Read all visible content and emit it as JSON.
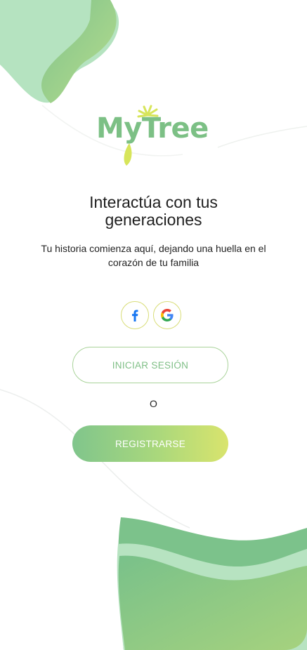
{
  "app": {
    "logo_text": "MyTree"
  },
  "hero": {
    "title_line1": "Interactúa con tus",
    "title_line2": "generaciones",
    "subtitle": "Tu historia comienza aquí, dejando una huella en el corazón de tu familia"
  },
  "social": [
    {
      "name": "facebook",
      "icon": "facebook-icon"
    },
    {
      "name": "google",
      "icon": "google-icon"
    }
  ],
  "actions": {
    "login_label": "INICIAR SESIÓN",
    "or_label": "O",
    "register_label": "REGISTRARSE"
  },
  "colors": {
    "brand_green": "#7cc085",
    "brand_lime": "#d9e46d",
    "outline": "#a9d39a"
  }
}
